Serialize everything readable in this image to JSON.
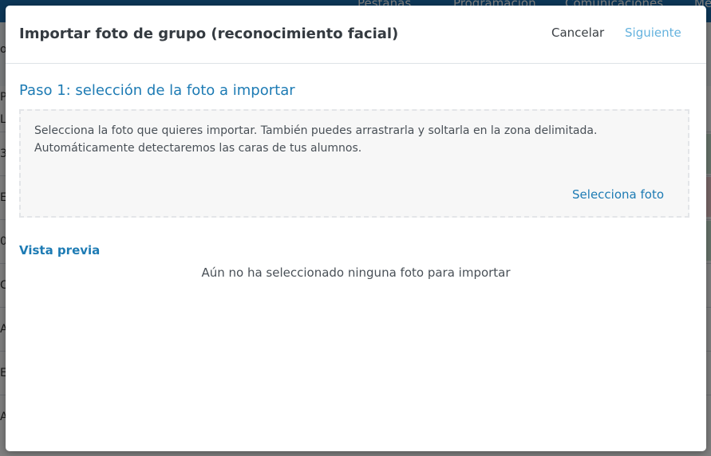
{
  "background": {
    "nav_items": [
      "Pestañas",
      "Programación",
      "Comunicaciones",
      "Me"
    ],
    "row_letters": [
      "o",
      "P",
      "L",
      "3",
      "E",
      "0",
      "C",
      "A",
      "E",
      "A"
    ]
  },
  "modal": {
    "title": "Importar foto de grupo (reconocimiento facial)",
    "cancel_label": "Cancelar",
    "next_label": "Siguiente",
    "step_title": "Paso 1: selección de la foto a importar",
    "drop_zone": {
      "instructions": "Selecciona la foto que quieres importar. También puedes arrastrarla y soltarla en la zona delimitada. Automáticamente detectaremos las caras de tus alumnos.",
      "select_label": "Selecciona foto"
    },
    "preview": {
      "title": "Vista previa",
      "empty_text": "Aún no ha seleccionado ninguna foto para importar"
    }
  }
}
